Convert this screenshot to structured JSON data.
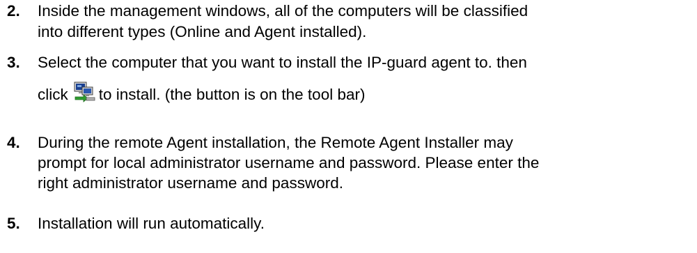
{
  "steps": [
    {
      "number": "2.",
      "lines": [
        "Inside the management windows, all of the computers will be classified",
        "into different types (Online and Agent installed)."
      ]
    },
    {
      "number": "3.",
      "lines": [
        "Select the computer that you want to install the IP-guard agent to.  then"
      ],
      "click_prefix": "click",
      "click_suffix": "to install. (the button is on the tool bar)",
      "icon": "install-agent-toolbar-icon"
    },
    {
      "number": "4.",
      "lines": [
        "During the remote Agent installation, the Remote Agent Installer may",
        "prompt for local administrator username and password. Please enter the",
        "right administrator username and password."
      ]
    },
    {
      "number": "5.",
      "lines": [
        "Installation will run automatically."
      ]
    }
  ]
}
